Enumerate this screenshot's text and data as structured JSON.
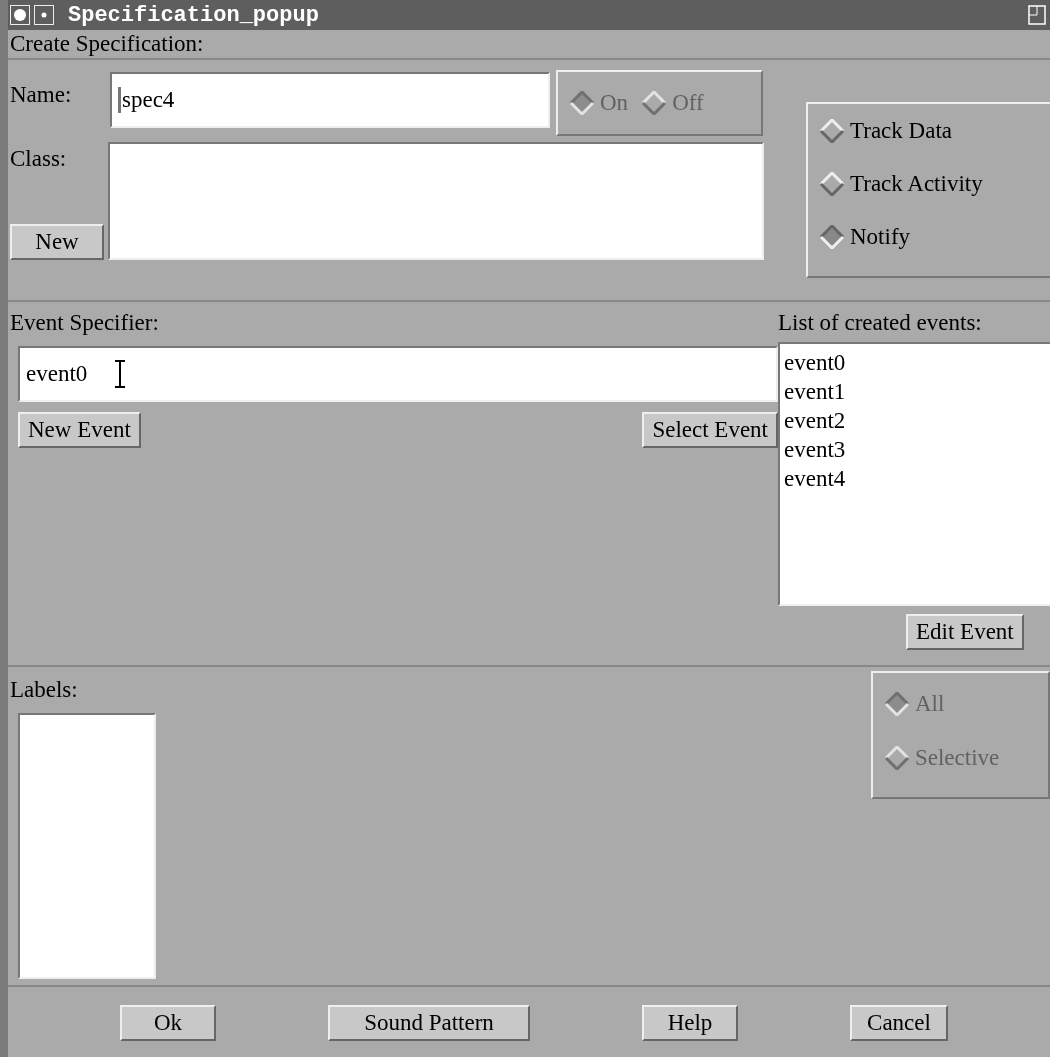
{
  "window": {
    "title": "Specification_popup"
  },
  "header": "Create Specification:",
  "name_field": {
    "label": "Name:",
    "value": "spec4"
  },
  "state_radios": {
    "disabled": true,
    "options": [
      {
        "label": "On",
        "selected": true
      },
      {
        "label": "Off",
        "selected": false
      }
    ]
  },
  "class_field": {
    "label": "Class:"
  },
  "new_button": "New",
  "mode_checks": [
    {
      "label": "Track Data",
      "selected": false
    },
    {
      "label": "Track Activity",
      "selected": false
    },
    {
      "label": "Notify",
      "selected": true
    }
  ],
  "event_specifier": {
    "label": "Event Specifier:",
    "value": "event0"
  },
  "event_buttons": {
    "new": "New Event",
    "select": "Select Event"
  },
  "events": {
    "label": "List of created events:",
    "items": [
      "event0",
      "event1",
      "event2",
      "event3",
      "event4"
    ],
    "edit_button": "Edit Event"
  },
  "labels": {
    "label": "Labels:"
  },
  "label_radios": {
    "disabled": true,
    "options": [
      {
        "label": "All",
        "selected": true
      },
      {
        "label": "Selective",
        "selected": false
      }
    ]
  },
  "footer_buttons": [
    "Ok",
    "Sound Pattern",
    "Help",
    "Cancel"
  ]
}
